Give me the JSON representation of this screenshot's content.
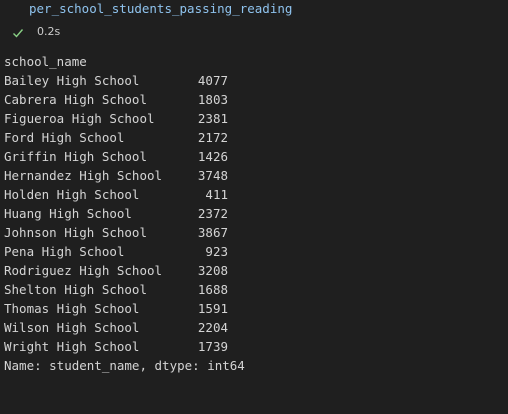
{
  "cell": {
    "code": "per_school_students_passing_reading"
  },
  "status": {
    "icon": "check-icon",
    "time": "0.2s",
    "color": "#89d185"
  },
  "output": {
    "index_name": "school_name",
    "rows": [
      {
        "name": "Bailey High School",
        "value": "4077"
      },
      {
        "name": "Cabrera High School",
        "value": "1803"
      },
      {
        "name": "Figueroa High School",
        "value": "2381"
      },
      {
        "name": "Ford High School",
        "value": "2172"
      },
      {
        "name": "Griffin High School",
        "value": "1426"
      },
      {
        "name": "Hernandez High School",
        "value": "3748"
      },
      {
        "name": "Holden High School",
        "value": "411"
      },
      {
        "name": "Huang High School",
        "value": "2372"
      },
      {
        "name": "Johnson High School",
        "value": "3867"
      },
      {
        "name": "Pena High School",
        "value": "923"
      },
      {
        "name": "Rodriguez High School",
        "value": "3208"
      },
      {
        "name": "Shelton High School",
        "value": "1688"
      },
      {
        "name": "Thomas High School",
        "value": "1591"
      },
      {
        "name": "Wilson High School",
        "value": "2204"
      },
      {
        "name": "Wright High School",
        "value": "1739"
      }
    ],
    "footer": "Name: student_name, dtype: int64"
  }
}
